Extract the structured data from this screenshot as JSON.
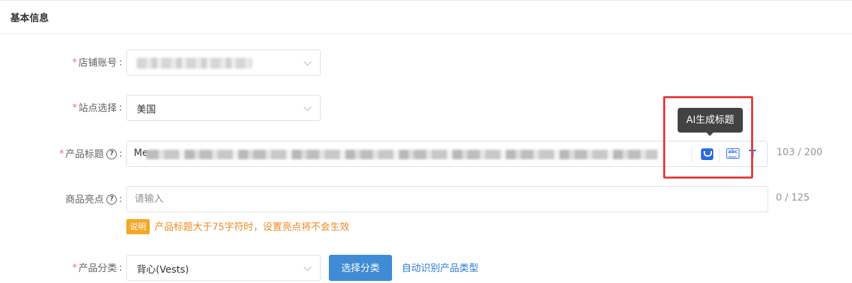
{
  "section": {
    "title": "基本信息"
  },
  "fields": {
    "store": {
      "label": "店铺账号",
      "colon": ":"
    },
    "site": {
      "label": "站点选择",
      "colon": ":",
      "value": "美国"
    },
    "title": {
      "label": "产品标题",
      "colon": ":",
      "value_prefix": "Me",
      "counter": "103 / 200"
    },
    "highlight": {
      "label": "商品亮点",
      "colon": ":",
      "placeholder": "请输入",
      "counter": "0 / 125"
    },
    "category": {
      "label": "产品分类",
      "colon": ":",
      "value": "背心(Vests)"
    }
  },
  "tooltip": {
    "text": "AI生成标题"
  },
  "note": {
    "badge": "说明",
    "text": "产品标题大于75字符时，设置亮点将不会生效"
  },
  "buttons": {
    "select_category": "选择分类",
    "auto_detect": "自动识别产品类型"
  },
  "icons": {
    "abc": "abc"
  },
  "colors": {
    "accent": "#3f8bd6",
    "required": "#f56c6c",
    "warning": "#f5a623",
    "highlight_box": "#e93a3a"
  }
}
